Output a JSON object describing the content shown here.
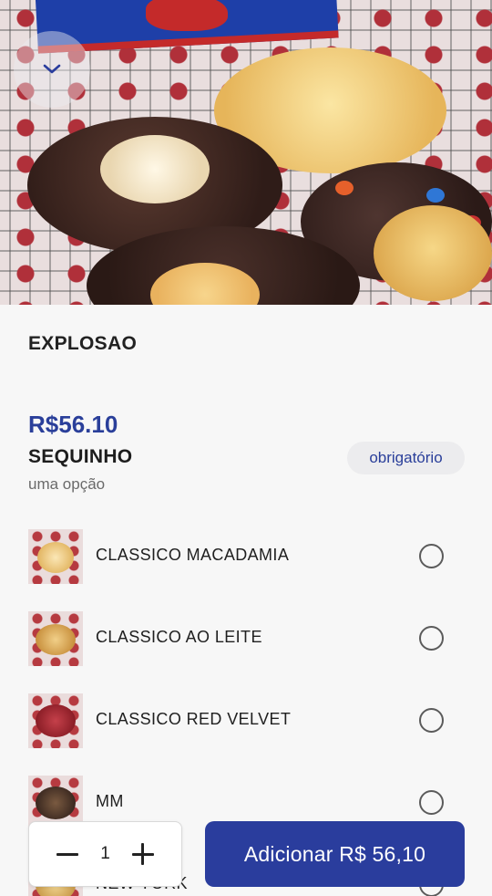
{
  "header": {
    "back_icon": "chevron-down-icon"
  },
  "product": {
    "name": "EXPLOSAO",
    "price": "R$56.10"
  },
  "option_group": {
    "title": "SEQUINHO",
    "subtitle": "uma opção",
    "badge": "obrigatório",
    "options": [
      {
        "label": "CLASSICO MACADAMIA",
        "selected": false
      },
      {
        "label": "CLASSICO AO LEITE",
        "selected": false
      },
      {
        "label": "CLASSICO RED VELVET",
        "selected": false
      },
      {
        "label": "MM",
        "selected": false
      },
      {
        "label": "NEW YORK",
        "selected": false
      }
    ]
  },
  "cart": {
    "quantity": "1",
    "decrement_icon": "minus-icon",
    "increment_icon": "plus-icon",
    "add_label": "Adicionar R$ 56,10"
  },
  "colors": {
    "accent": "#2a3d9d",
    "price": "#2a3f9a",
    "badge_bg": "#ececee"
  }
}
